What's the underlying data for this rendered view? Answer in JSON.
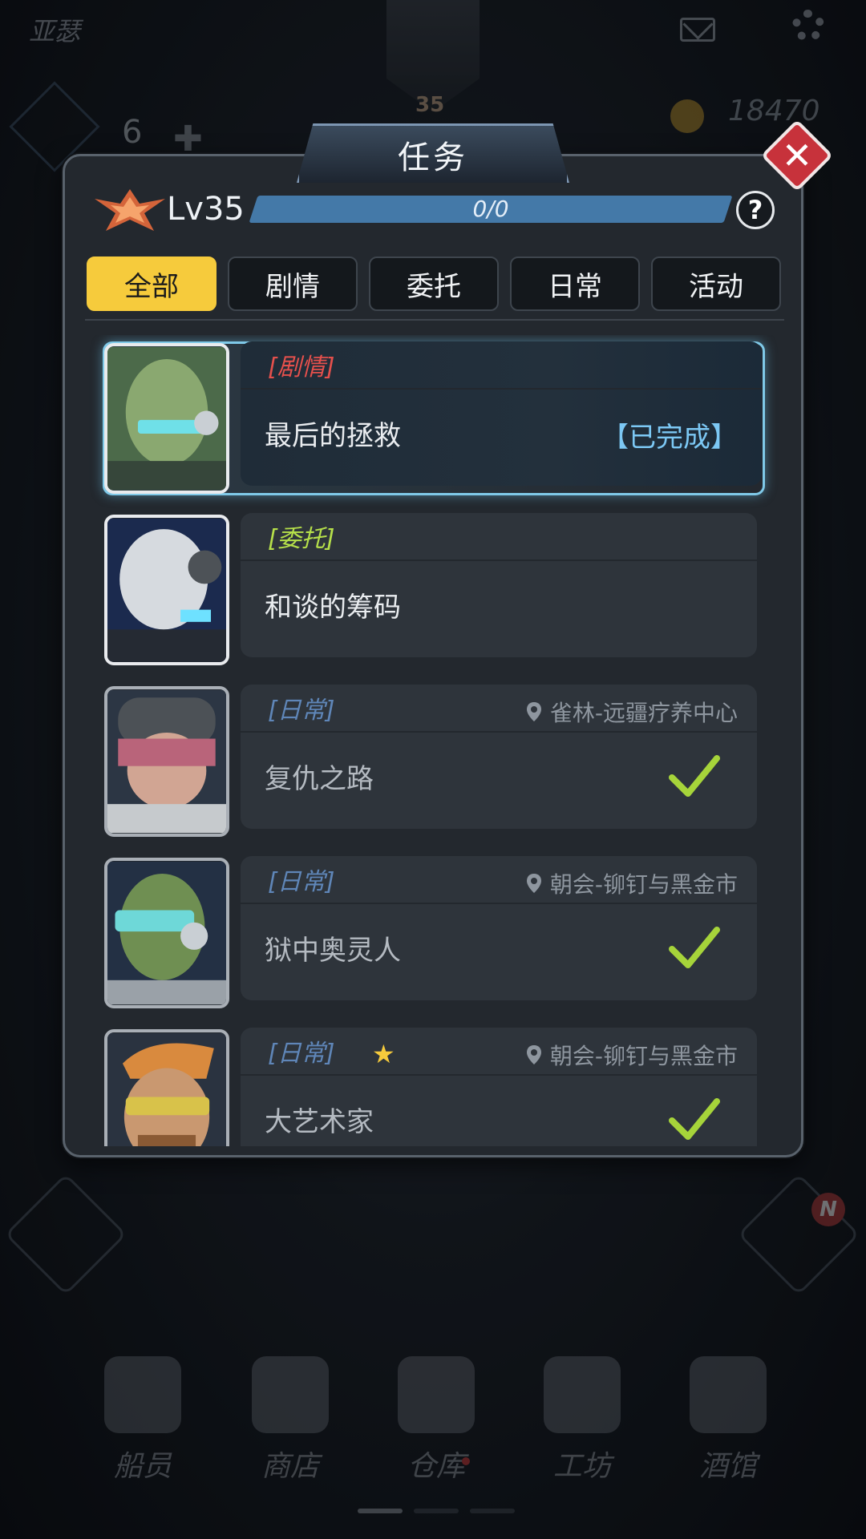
{
  "hud": {
    "player_name": "亚瑟",
    "avatar_level": "35",
    "energy": "6",
    "coins": "18470"
  },
  "modal": {
    "title": "任务",
    "close_icon": "close-icon",
    "level_label": "Lv35",
    "progress_text": "0/0",
    "progress_fraction": 0,
    "help_label": "?",
    "tabs": [
      {
        "label": "全部",
        "active": true
      },
      {
        "label": "剧情",
        "active": false
      },
      {
        "label": "委托",
        "active": false
      },
      {
        "label": "日常",
        "active": false
      },
      {
        "label": "活动",
        "active": false
      }
    ],
    "quests": [
      {
        "category": "[剧情]",
        "category_color": "#e5504c",
        "name": "最后的拯救",
        "status": "【已完成】",
        "location": "",
        "completed_check": false,
        "starred": false
      },
      {
        "category": "[委托]",
        "category_color": "#b6e04a",
        "name": "和谈的筹码",
        "status": "",
        "location": "",
        "completed_check": false,
        "starred": false
      },
      {
        "category": "[日常]",
        "category_color": "#5f86b8",
        "name": "复仇之路",
        "status": "",
        "location": "雀林-远疆疗养中心",
        "completed_check": true,
        "starred": false
      },
      {
        "category": "[日常]",
        "category_color": "#5f86b8",
        "name": "狱中奥灵人",
        "status": "",
        "location": "朝会-铆钉与黑金市",
        "completed_check": true,
        "starred": false
      },
      {
        "category": "[日常]",
        "category_color": "#5f86b8",
        "name": "大艺术家",
        "status": "",
        "location": "朝会-铆钉与黑金市",
        "completed_check": true,
        "starred": true
      }
    ]
  },
  "side": {
    "right_badge": "N"
  },
  "bottom_nav": [
    {
      "label": "船员",
      "icon": "crew-icon"
    },
    {
      "label": "商店",
      "icon": "shop-icon"
    },
    {
      "label": "仓库",
      "icon": "storage-chest-icon",
      "dot": true
    },
    {
      "label": "工坊",
      "icon": "workshop-hammer-icon"
    },
    {
      "label": "酒馆",
      "icon": "tavern-beer-icon"
    }
  ],
  "colors": {
    "accent_yellow": "#f6cb3c",
    "progress_blue": "#4479a8",
    "completed_blue": "#7cc8f4",
    "check_green": "#a6d43a",
    "close_red": "#c7323b"
  }
}
